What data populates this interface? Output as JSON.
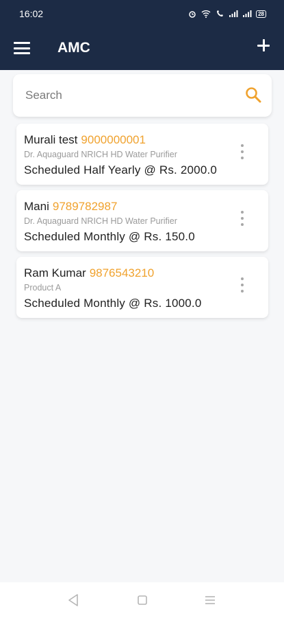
{
  "status_bar": {
    "time": "16:02",
    "battery": "28"
  },
  "app_bar": {
    "title": "AMC",
    "menu_icon": "hamburger-menu-icon",
    "add_icon": "plus-icon",
    "background_color": "#1c2b45"
  },
  "search": {
    "placeholder": "Search",
    "value": "",
    "icon": "search-icon",
    "icon_color": "#f0a22e"
  },
  "accent_color": "#f0a22e",
  "amc_list": [
    {
      "name": "Murali test",
      "phone": "9000000001",
      "product": "Dr. Aquaguard NRICH HD Water Purifier",
      "schedule": "Scheduled Half Yearly @ Rs. 2000.0"
    },
    {
      "name": "Mani",
      "phone": "9789782987",
      "product": "Dr. Aquaguard NRICH HD Water Purifier",
      "schedule": "Scheduled Monthly @ Rs. 150.0"
    },
    {
      "name": "Ram Kumar",
      "phone": "9876543210",
      "product": "Product A",
      "schedule": "Scheduled Monthly @ Rs. 1000.0"
    }
  ],
  "nav_bar": {
    "back_icon": "triangle-back-icon",
    "home_icon": "square-home-icon",
    "recents_icon": "lines-recents-icon"
  }
}
